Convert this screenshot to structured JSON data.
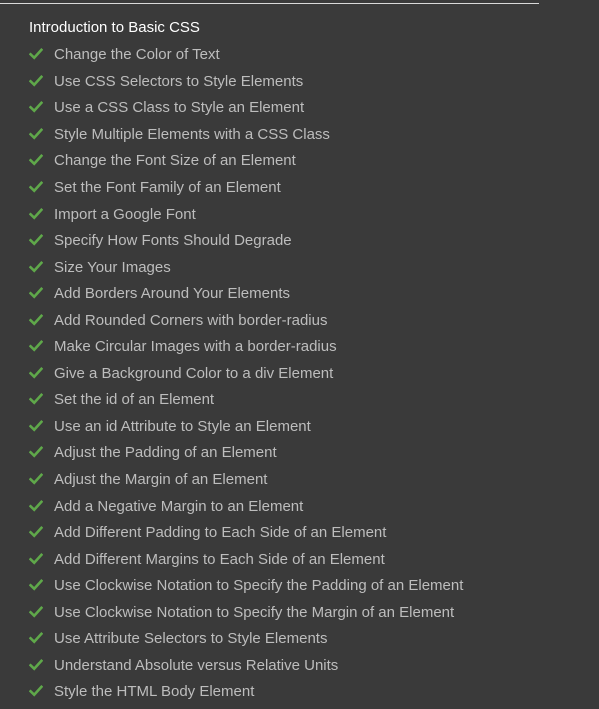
{
  "colors": {
    "background": "#3a3a3a",
    "title_text": "#ffffff",
    "item_text": "#bdbdbd",
    "check": "#5fa84a"
  },
  "section": {
    "title": "Introduction to Basic CSS"
  },
  "lessons": [
    {
      "label": "Change the Color of Text",
      "completed": true,
      "icon": "check-icon"
    },
    {
      "label": "Use CSS Selectors to Style Elements",
      "completed": true,
      "icon": "check-icon"
    },
    {
      "label": "Use a CSS Class to Style an Element",
      "completed": true,
      "icon": "check-icon"
    },
    {
      "label": "Style Multiple Elements with a CSS Class",
      "completed": true,
      "icon": "check-icon"
    },
    {
      "label": "Change the Font Size of an Element",
      "completed": true,
      "icon": "check-icon"
    },
    {
      "label": "Set the Font Family of an Element",
      "completed": true,
      "icon": "check-icon"
    },
    {
      "label": "Import a Google Font",
      "completed": true,
      "icon": "check-icon"
    },
    {
      "label": "Specify How Fonts Should Degrade",
      "completed": true,
      "icon": "check-icon"
    },
    {
      "label": "Size Your Images",
      "completed": true,
      "icon": "check-icon"
    },
    {
      "label": "Add Borders Around Your Elements",
      "completed": true,
      "icon": "check-icon"
    },
    {
      "label": "Add Rounded Corners with border-radius",
      "completed": true,
      "icon": "check-icon"
    },
    {
      "label": "Make Circular Images with a border-radius",
      "completed": true,
      "icon": "check-icon"
    },
    {
      "label": "Give a Background Color to a div Element",
      "completed": true,
      "icon": "check-icon"
    },
    {
      "label": "Set the id of an Element",
      "completed": true,
      "icon": "check-icon"
    },
    {
      "label": "Use an id Attribute to Style an Element",
      "completed": true,
      "icon": "check-icon"
    },
    {
      "label": "Adjust the Padding of an Element",
      "completed": true,
      "icon": "check-icon"
    },
    {
      "label": "Adjust the Margin of an Element",
      "completed": true,
      "icon": "check-icon"
    },
    {
      "label": "Add a Negative Margin to an Element",
      "completed": true,
      "icon": "check-icon"
    },
    {
      "label": "Add Different Padding to Each Side of an Element",
      "completed": true,
      "icon": "check-icon"
    },
    {
      "label": "Add Different Margins to Each Side of an Element",
      "completed": true,
      "icon": "check-icon"
    },
    {
      "label": "Use Clockwise Notation to Specify the Padding of an Element",
      "completed": true,
      "icon": "check-icon"
    },
    {
      "label": "Use Clockwise Notation to Specify the Margin of an Element",
      "completed": true,
      "icon": "check-icon"
    },
    {
      "label": "Use Attribute Selectors to Style Elements",
      "completed": true,
      "icon": "check-icon"
    },
    {
      "label": "Understand Absolute versus Relative Units",
      "completed": true,
      "icon": "check-icon"
    },
    {
      "label": "Style the HTML Body Element",
      "completed": true,
      "icon": "check-icon"
    }
  ]
}
